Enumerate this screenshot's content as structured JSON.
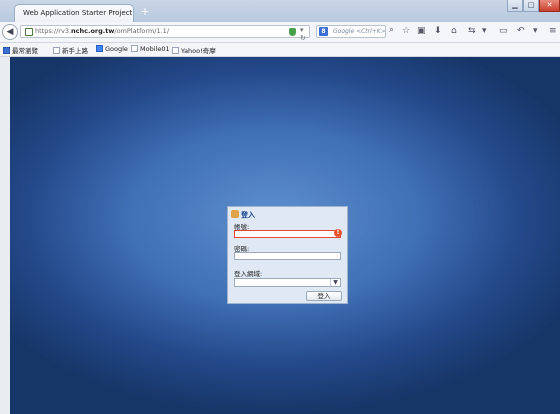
{
  "browser": {
    "tab_title": "Web Application Starter Project",
    "new_tab_label": "+",
    "url_prefix": "https://rv3.",
    "url_domain": "nchc.org.tw",
    "url_path": "/omPlatform/1.1/",
    "search_placeholder": "Google <Ctrl+K>",
    "search_engine_letter": "8"
  },
  "bookmarks": [
    {
      "label": "最常瀏覽"
    },
    {
      "label": "新手上路"
    },
    {
      "label": "Google"
    },
    {
      "label": "Mobile01"
    },
    {
      "label": "Yahoo!奇摩"
    }
  ],
  "login": {
    "header": "登入",
    "account_label": "帳號:",
    "account_value": "",
    "password_label": "密碼:",
    "password_value": "",
    "domain_label": "登入網域:",
    "domain_selected": "",
    "submit_label": "登入",
    "error_badge": "!"
  },
  "colors": {
    "invalid_border": "#e0483a",
    "error_icon": "#e8542e",
    "dialog_bg": "#dfe8f3",
    "header_text": "#15428b"
  }
}
